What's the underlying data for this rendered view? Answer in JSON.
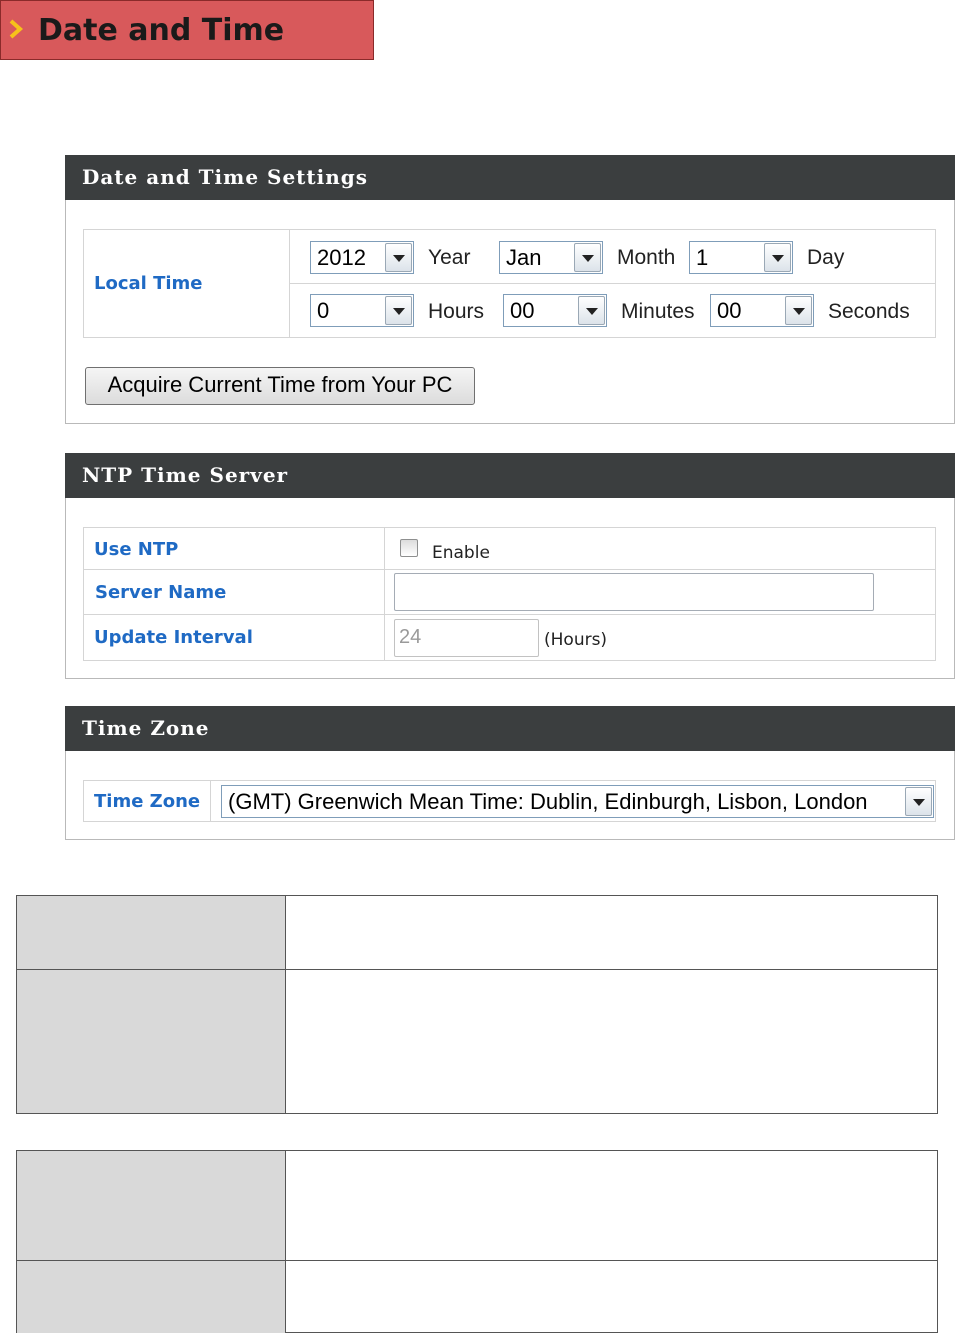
{
  "header": {
    "title": "Date and Time",
    "icon": "chevron-right-icon",
    "accent": "#d8595b"
  },
  "date_time_settings": {
    "title": "Date and Time Settings",
    "local_time_label": "Local Time",
    "year": {
      "value": "2012",
      "unit": "Year"
    },
    "month": {
      "value": "Jan",
      "unit": "Month"
    },
    "day": {
      "value": "1",
      "unit": "Day"
    },
    "hours": {
      "value": "0",
      "unit": "Hours"
    },
    "minutes": {
      "value": "00",
      "unit": "Minutes"
    },
    "seconds": {
      "value": "00",
      "unit": "Seconds"
    },
    "acquire_button": "Acquire Current Time from Your PC"
  },
  "ntp": {
    "title": "NTP Time Server",
    "use_ntp_label": "Use NTP",
    "enable_label": "Enable",
    "enable_checked": false,
    "server_name_label": "Server Name",
    "server_name_value": "",
    "update_interval_label": "Update Interval",
    "update_interval_value": "24",
    "update_interval_unit": "(Hours)"
  },
  "time_zone": {
    "title": "Time Zone",
    "label": "Time Zone",
    "value": "(GMT) Greenwich Mean Time: Dublin, Edinburgh, Lisbon, London"
  },
  "colors": {
    "panel_header": "#3b3e3f",
    "label_blue": "#1f6ac4",
    "desc_label_bg": "#d9d9d9"
  }
}
